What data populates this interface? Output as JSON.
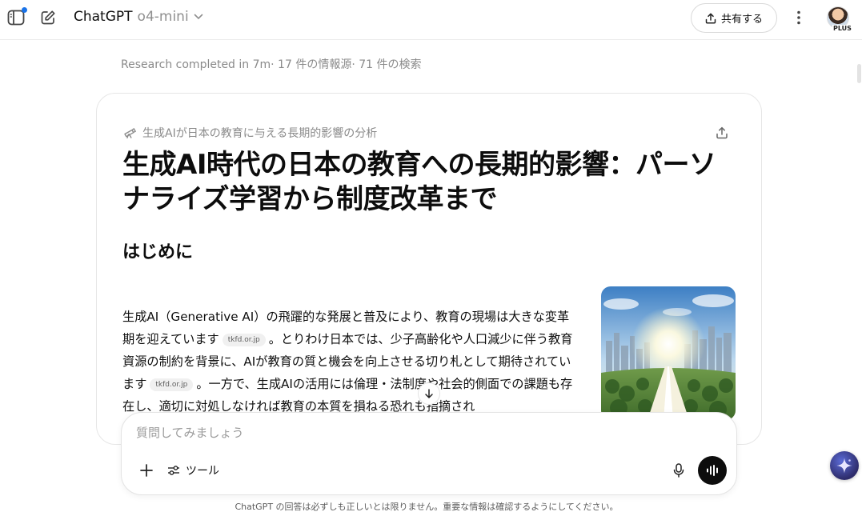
{
  "header": {
    "brand": "ChatGPT",
    "model": "o4-mini",
    "share_label": "共有する",
    "avatar_badge": "PLUS"
  },
  "research": {
    "status": "Research completed in 7m· 17 件の情報源· 71 件の検索"
  },
  "report": {
    "topic": "生成AIが日本の教育に与える長期的影響の分析",
    "title": "生成AI時代の日本の教育への長期的影響：パーソナライズ学習から制度改革まで",
    "section_heading": "はじめに",
    "para_1": "生成AI（Generative AI）の飛躍的な発展と普及により、教育の現場は大きな変革期を迎えています",
    "cite_1": "tkfd.or.jp",
    "para_2": "。とりわけ日本では、少子高齢化や人口減少に伴う教育資源の制約を背景に、AIが教育の質と機会を向上させる切り札として期待されています",
    "cite_2": "tkfd.or.jp",
    "para_3": "。一方で、生成AIの活用には倫理・法制度や社会的側面での課題も存在し、適切に対処しなければ教育の本質を損ねる恐れも指摘され"
  },
  "composer": {
    "placeholder": "質問してみましょう",
    "tools_label": "ツール"
  },
  "footer": {
    "disclaimer": "ChatGPT の回答は必ずしも正しいとは限りません。重要な情報は確認するようにしてください。"
  },
  "colors": {
    "accent_dot": "#1a73e8",
    "primary_text": "#0d0d0d",
    "muted_text": "#8a8a8a"
  },
  "icons": {
    "sidebar": "sidebar-toggle-icon",
    "new_chat": "pencil-square-icon",
    "share": "upload-icon",
    "more": "vertical-dots-icon",
    "topic": "telescope-icon",
    "export": "export-icon",
    "scroll_down": "arrow-down-icon",
    "attach": "plus-icon",
    "tools": "sliders-icon",
    "mic": "microphone-icon",
    "voice": "voice-wave-icon",
    "assistant": "sparkle-icon"
  }
}
